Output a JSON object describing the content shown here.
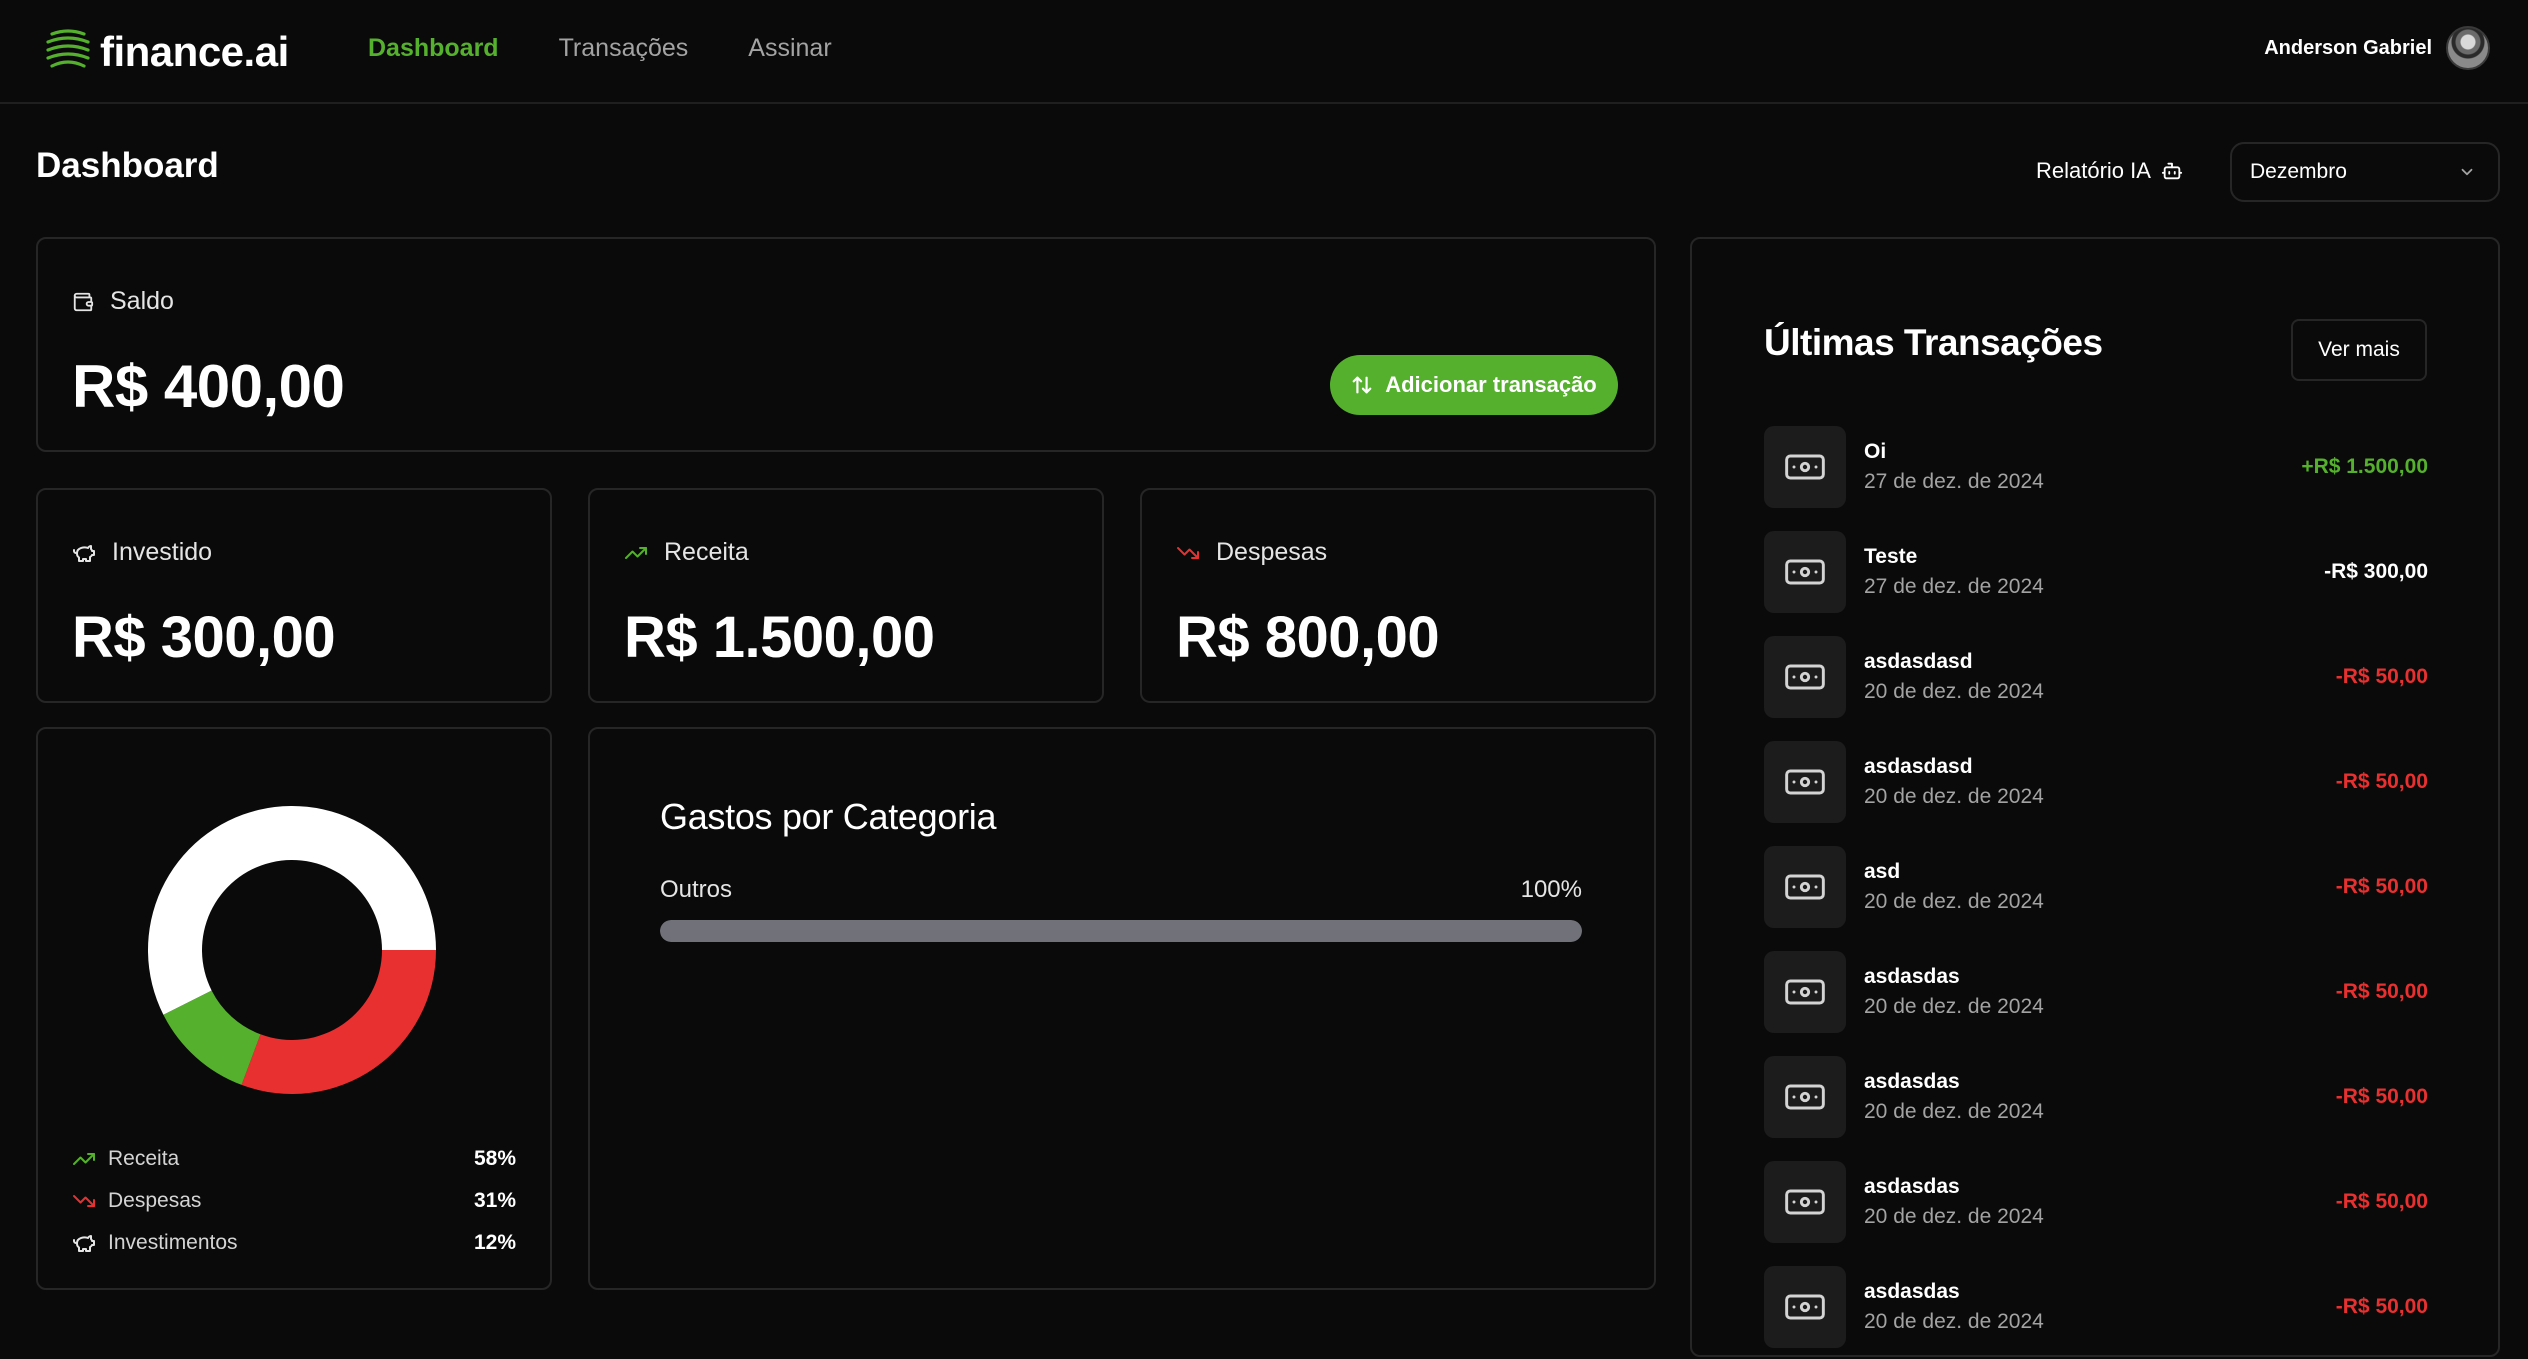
{
  "app": {
    "name": "finance.ai"
  },
  "nav": {
    "items": [
      {
        "label": "Dashboard",
        "active": true
      },
      {
        "label": "Transações",
        "active": false
      },
      {
        "label": "Assinar",
        "active": false
      }
    ]
  },
  "user": {
    "name": "Anderson Gabriel"
  },
  "header": {
    "title": "Dashboard",
    "ai_report": "Relatório IA",
    "month": "Dezembro"
  },
  "summary": {
    "balance": {
      "label": "Saldo",
      "value": "R$ 400,00",
      "add_button": "Adicionar transação"
    },
    "invested": {
      "label": "Investido",
      "value": "R$ 300,00"
    },
    "income": {
      "label": "Receita",
      "value": "R$ 1.500,00"
    },
    "expenses": {
      "label": "Despesas",
      "value": "R$ 800,00"
    }
  },
  "colors": {
    "accent": "#55b02e",
    "income": "#55b02e",
    "expense": "#e93030",
    "invest": "#ffffff",
    "bar": "#71717a"
  },
  "chart_data": {
    "type": "pie",
    "variant": "donut",
    "categories": [
      "Receita",
      "Despesas",
      "Investimentos"
    ],
    "values": [
      58,
      31,
      12
    ],
    "colors": [
      "#ffffff",
      "#e93030",
      "#55b02e"
    ]
  },
  "legend": [
    {
      "label": "Receita",
      "pct": "58%",
      "icon": "trending-up-icon"
    },
    {
      "label": "Despesas",
      "pct": "31%",
      "icon": "trending-down-icon"
    },
    {
      "label": "Investimentos",
      "pct": "12%",
      "icon": "piggy-bank-icon"
    }
  ],
  "categories": {
    "title": "Gastos por Categoria",
    "items": [
      {
        "name": "Outros",
        "pct_label": "100%",
        "fraction": 1.0
      }
    ]
  },
  "transactions": {
    "title": "Últimas Transações",
    "more_button": "Ver mais",
    "items": [
      {
        "name": "Oi",
        "date": "27 de dez. de 2024",
        "amount": "+R$ 1.500,00",
        "kind": "income"
      },
      {
        "name": "Teste",
        "date": "27 de dez. de 2024",
        "amount": "-R$ 300,00",
        "kind": "invest"
      },
      {
        "name": "asdasdasd",
        "date": "20 de dez. de 2024",
        "amount": "-R$ 50,00",
        "kind": "expense"
      },
      {
        "name": "asdasdasd",
        "date": "20 de dez. de 2024",
        "amount": "-R$ 50,00",
        "kind": "expense"
      },
      {
        "name": "asd",
        "date": "20 de dez. de 2024",
        "amount": "-R$ 50,00",
        "kind": "expense"
      },
      {
        "name": "asdasdas",
        "date": "20 de dez. de 2024",
        "amount": "-R$ 50,00",
        "kind": "expense"
      },
      {
        "name": "asdasdas",
        "date": "20 de dez. de 2024",
        "amount": "-R$ 50,00",
        "kind": "expense"
      },
      {
        "name": "asdasdas",
        "date": "20 de dez. de 2024",
        "amount": "-R$ 50,00",
        "kind": "expense"
      },
      {
        "name": "asdasdas",
        "date": "20 de dez. de 2024",
        "amount": "-R$ 50,00",
        "kind": "expense"
      }
    ]
  }
}
